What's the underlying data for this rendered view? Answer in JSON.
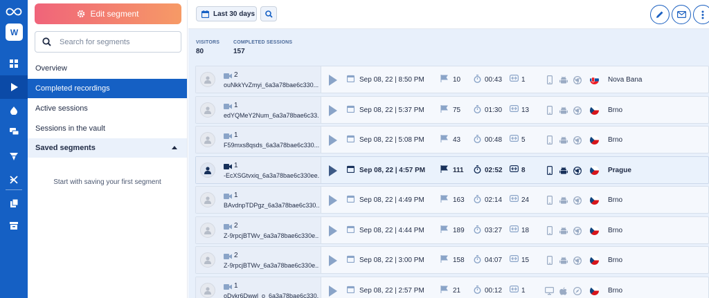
{
  "rail": {
    "workspace_initial": "W",
    "icons": [
      "dashboard-icon",
      "recordings-icon",
      "heatmaps-icon",
      "feedback-icon",
      "funnels-icon",
      "experiments-icon",
      "reports-icon",
      "archive-icon"
    ],
    "active_icon": "recordings-icon"
  },
  "sidebar": {
    "edit_segment_label": "Edit segment",
    "search_placeholder": "Search for segments",
    "nav": [
      {
        "label": "Overview",
        "active": false
      },
      {
        "label": "Completed recordings",
        "active": true
      },
      {
        "label": "Active sessions",
        "active": false
      },
      {
        "label": "Sessions in the vault",
        "active": false
      }
    ],
    "saved_segments_label": "Saved segments",
    "empty_message": "Start with saving your first segment"
  },
  "topbar": {
    "date_range_label": "Last 30 days"
  },
  "stats": {
    "visitors_label": "VISITORS",
    "visitors_value": "80",
    "sessions_label": "COMPLETED SESSIONS",
    "sessions_value": "157"
  },
  "colors": {
    "primary": "#1560c4",
    "edit_gradient_start": "#f0647a",
    "edit_gradient_end": "#f69a66",
    "background": "#e8f0fb"
  },
  "recordings": [
    {
      "count": "2",
      "id": "ouNkkYvZmyi_6a3a78bae6c330...",
      "date": "Sep 08, 22 | 8:50 PM",
      "events": "10",
      "duration": "00:43",
      "pages": "1",
      "device": "mobile",
      "os": "android",
      "browser": "chrome",
      "country": "Slovakia",
      "city": "Nova Bana"
    },
    {
      "count": "1",
      "id": "edYQMeY2Num_6a3a78bae6c33...",
      "date": "Sep 08, 22 | 5:37 PM",
      "events": "75",
      "duration": "01:30",
      "pages": "13",
      "device": "mobile",
      "os": "android",
      "browser": "chrome",
      "country": "Czechia",
      "city": "Brno"
    },
    {
      "count": "1",
      "id": "F59mxs8qsds_6a3a78bae6c330...",
      "date": "Sep 08, 22 | 5:08 PM",
      "events": "43",
      "duration": "00:48",
      "pages": "5",
      "device": "mobile",
      "os": "android",
      "browser": "chrome",
      "country": "Czechia",
      "city": "Brno"
    },
    {
      "count": "1",
      "id": "-EcXSGtvxiq_6a3a78bae6c330ee...",
      "date": "Sep 08, 22 | 4:57 PM",
      "events": "111",
      "duration": "02:52",
      "pages": "8",
      "device": "mobile",
      "os": "android",
      "browser": "chrome",
      "country": "Czechia",
      "city": "Prague",
      "highlight": true
    },
    {
      "count": "1",
      "id": "BAvdnpTDPgz_6a3a78bae6c330...",
      "date": "Sep 08, 22 | 4:49 PM",
      "events": "163",
      "duration": "02:14",
      "pages": "24",
      "device": "mobile",
      "os": "android",
      "browser": "chrome",
      "country": "Czechia",
      "city": "Brno"
    },
    {
      "count": "2",
      "id": "Z-9rpcjBTWv_6a3a78bae6c330e...",
      "date": "Sep 08, 22 | 4:44 PM",
      "events": "189",
      "duration": "03:27",
      "pages": "18",
      "device": "mobile",
      "os": "android",
      "browser": "chrome",
      "country": "Czechia",
      "city": "Brno"
    },
    {
      "count": "2",
      "id": "Z-9rpcjBTWv_6a3a78bae6c330e...",
      "date": "Sep 08, 22 | 3:00 PM",
      "events": "158",
      "duration": "04:07",
      "pages": "15",
      "device": "mobile",
      "os": "android",
      "browser": "chrome",
      "country": "Czechia",
      "city": "Brno"
    },
    {
      "count": "1",
      "id": "oDvkr6Dwwl_o_6a3a78bae6c330...",
      "date": "Sep 08, 22 | 2:57 PM",
      "events": "21",
      "duration": "00:12",
      "pages": "1",
      "device": "desktop",
      "os": "apple",
      "browser": "safari",
      "country": "Czechia",
      "city": "Brno"
    }
  ]
}
